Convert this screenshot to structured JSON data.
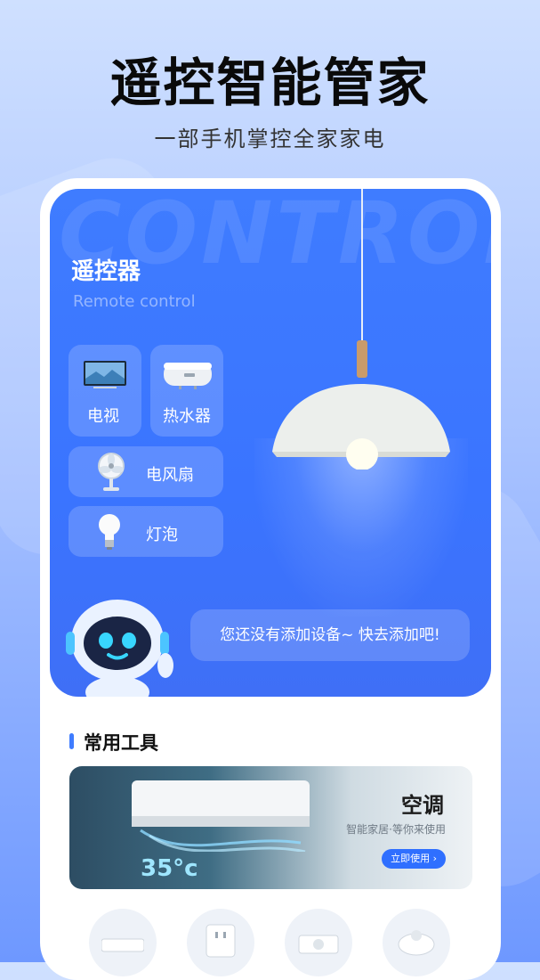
{
  "hero": {
    "title": "遥控智能管家",
    "subtitle": "一部手机掌控全家家电"
  },
  "remote": {
    "watermark": "CONTROL",
    "title": "遥控器",
    "subtitle": "Remote control",
    "devices": [
      {
        "label": "电视",
        "icon": "tv-icon"
      },
      {
        "label": "热水器",
        "icon": "water-heater-icon"
      },
      {
        "label": "电风扇",
        "icon": "fan-icon"
      },
      {
        "label": "灯泡",
        "icon": "bulb-icon"
      }
    ],
    "empty_message": "您还没有添加设备~ 快去添加吧!"
  },
  "tools": {
    "section_title": "常用工具",
    "banner": {
      "title": "空调",
      "subtitle": "智能家居·等你来使用",
      "button": "立即使用",
      "temperature": "35°c"
    },
    "items": [
      {
        "icon": "router-icon"
      },
      {
        "icon": "socket-icon"
      },
      {
        "icon": "projector-icon"
      },
      {
        "icon": "robot-vacuum-icon"
      }
    ]
  },
  "colors": {
    "accent": "#3f7cff",
    "page_background": "#a9c3ff"
  }
}
